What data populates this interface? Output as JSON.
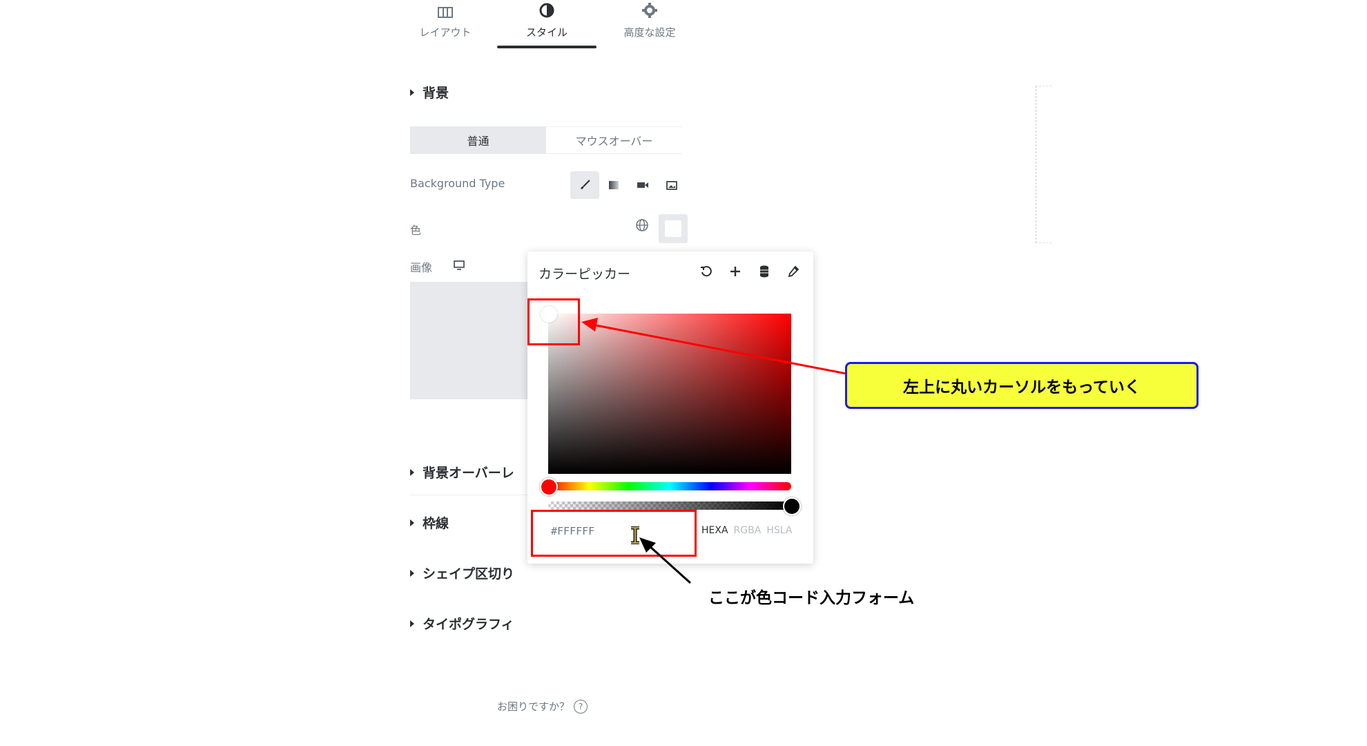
{
  "tabs": [
    {
      "label": "レイアウト",
      "icon": "layout-icon"
    },
    {
      "label": "スタイル",
      "icon": "half-circle-icon"
    },
    {
      "label": "高度な設定",
      "icon": "gear-icon"
    }
  ],
  "sections": {
    "background": "背景",
    "overlay": "背景オーバーレ",
    "border": "枠線",
    "shape_divider": "シェイプ区切り",
    "typography": "タイポグラフィ"
  },
  "state_toggle": {
    "normal": "普通",
    "hover": "マウスオーバー"
  },
  "controls": {
    "background_type_label": "Background Type",
    "color_label": "色",
    "image_label": "画像"
  },
  "picker": {
    "title": "カラーピッカー",
    "hex_value": "#FFFFFF",
    "formats": [
      "HEXA",
      "RGBA",
      "HSLA"
    ],
    "active_format": "HEXA"
  },
  "annotations": {
    "callout": "左上に丸いカーソルをもっていく",
    "input_note": "ここが色コード入力フォーム"
  },
  "help": {
    "text": "お困りですか？",
    "icon": "question-icon"
  },
  "colors": {
    "annotation_red": "#ff0000",
    "callout_fill": "#f6ff3a",
    "callout_border": "#1a1af2"
  }
}
